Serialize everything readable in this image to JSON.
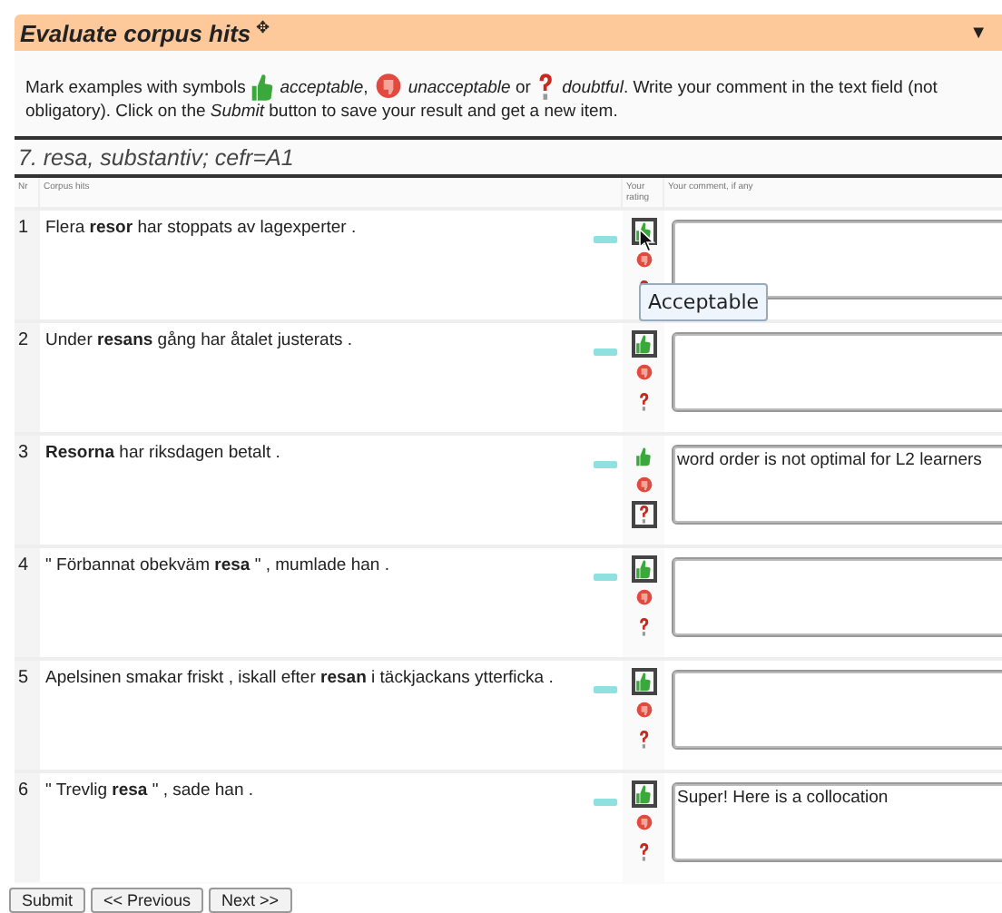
{
  "panel": {
    "title": "Evaluate corpus hits",
    "move_glyph": "✥",
    "collapse_glyph": "▼"
  },
  "instruction": [
    {
      "kind": "text",
      "text": "Mark examples with symbols"
    },
    {
      "kind": "acceptable"
    },
    {
      "kind": "text",
      "text": "*acceptable*,"
    },
    {
      "kind": "unacceptable"
    },
    {
      "kind": "text",
      "text": "*unacceptable* or"
    },
    {
      "kind": "doubtful"
    },
    {
      "kind": "text",
      "text": "*doubtful*. Write your comment in the text field (not"
    },
    {
      "kind": "text",
      "text": "obligatory). Click on the *Submit* button to save your result and get a new item."
    }
  ],
  "item_heading": "7. resa, substantiv; cefr=A1",
  "columns": [
    "Nr",
    "Corpus hits",
    "Your rating",
    "Your comment, if any"
  ],
  "rows": [
    {
      "nr": "1",
      "text": "Flera **resor** har stoppats av lagexperter .",
      "ratings": [
        {
          "kind": "acceptable",
          "selected": true
        },
        {
          "kind": "unacceptable",
          "selected": false
        },
        {
          "kind": "doubtful",
          "selected": false
        }
      ],
      "comment": "",
      "tooltip": "Acceptable"
    },
    {
      "nr": "2",
      "text": "Under **resans** gång har åtalet justerats .",
      "ratings": [
        {
          "kind": "acceptable",
          "selected": true
        },
        {
          "kind": "unacceptable",
          "selected": false
        },
        {
          "kind": "doubtful",
          "selected": false
        }
      ],
      "comment": ""
    },
    {
      "nr": "3",
      "text": "**Resorna** har riksdagen betalt .",
      "ratings": [
        {
          "kind": "acceptable",
          "selected": false
        },
        {
          "kind": "unacceptable",
          "selected": false
        },
        {
          "kind": "doubtful",
          "selected": true
        }
      ],
      "comment": "word order is not optimal for L2 learners"
    },
    {
      "nr": "4",
      "text": "\" Förbannat obekväm **resa** \" , mumlade han .",
      "ratings": [
        {
          "kind": "acceptable",
          "selected": true
        },
        {
          "kind": "unacceptable",
          "selected": false
        },
        {
          "kind": "doubtful",
          "selected": false
        }
      ],
      "comment": ""
    },
    {
      "nr": "5",
      "text": "Apelsinen smakar friskt , iskall efter **resan** i täckjackans ytterficka .",
      "ratings": [
        {
          "kind": "acceptable",
          "selected": true
        },
        {
          "kind": "unacceptable",
          "selected": false
        },
        {
          "kind": "doubtful",
          "selected": false
        }
      ],
      "comment": ""
    },
    {
      "nr": "6",
      "text": "\" Trevlig **resa** \" , sade han .",
      "ratings": [
        {
          "kind": "acceptable",
          "selected": true
        },
        {
          "kind": "unacceptable",
          "selected": false
        },
        {
          "kind": "doubtful",
          "selected": false
        }
      ],
      "comment": "Super! Here is a collocation"
    }
  ],
  "buttons": [
    "Submit",
    "<< Previous",
    "Next >>"
  ]
}
